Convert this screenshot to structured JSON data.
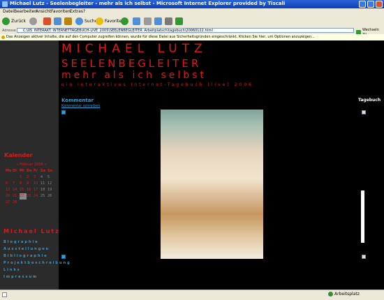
{
  "window": {
    "title": "Michael Lutz - Seelenbegleiter - mehr als ich selbst - Microsoft Internet Explorer provided by Tiscali"
  },
  "menu": [
    "Datei",
    "Bearbeiten",
    "Ansicht",
    "Favoriten",
    "Extras",
    "?"
  ],
  "toolbar": {
    "back_label": "Zurück",
    "search_label": "Suchen",
    "favorites_label": "Favoriten"
  },
  "address": {
    "label": "Adresse",
    "url": "C:\\05_INTERAKT. INTERNETTAGEBUCH-LIVE_2005\\SEELENBEGLEITER_Arbeitplatsch\\tagebuch\\20060122.html",
    "go_label": "Wechseln zu"
  },
  "infobar": {
    "text": "Das Anzeigen aktiver Inhalte, die auf den Computer zugreifen können, wurde für diese Datei aus Sicherheitsgründen eingeschränkt. Klicken Sie hier, um Optionen anzuzeigen..."
  },
  "page": {
    "title": "MICHAEL LUTZ",
    "subtitle": "SEELENBEGLEITER",
    "subtitle2": "mehr als ich selbst",
    "tagline": "ein interaktives Internet-Tagebuch (live) 2006",
    "comment_heading": "Kommentar",
    "comment_link": "Kommentar schreiben",
    "diary_label": "Tagebuch"
  },
  "calendar": {
    "heading": "Kalender",
    "month_label": "« Februar 2006 »",
    "weekdays": [
      "Mo",
      "Di",
      "Mi",
      "Do",
      "Fr",
      "Sa",
      "So"
    ],
    "days": [
      "",
      "",
      "1",
      "2",
      "3",
      "4",
      "5",
      "6",
      "7",
      "8",
      "9",
      "10",
      "11",
      "12",
      "13",
      "14",
      "15",
      "16",
      "17",
      "18",
      "19",
      "20",
      "21",
      "22",
      "23",
      "24",
      "25",
      "26",
      "27",
      "28",
      "",
      "",
      "",
      "",
      ""
    ],
    "selected_day": "22"
  },
  "nav": {
    "heading": "Michael Lutz",
    "items": [
      "Biographie",
      "Ausstellungen",
      "Bibliographie",
      "Projektbeschreibung",
      "Links",
      "Impressum"
    ]
  },
  "status": {
    "zone_label": "Arbeitsplatz"
  },
  "colors": {
    "accent_red": "#e21818",
    "link_blue": "#2aa0d8",
    "sidebar_bg": "#2b2b2b"
  }
}
